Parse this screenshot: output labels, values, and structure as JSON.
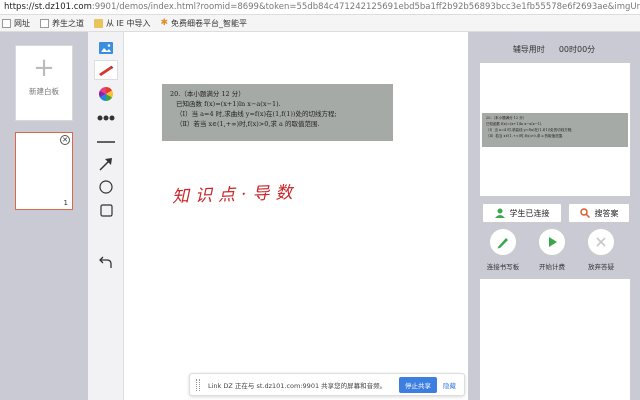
{
  "browser": {
    "url_host": "https://st.dz101.com",
    "url_rest": ":9901/demos/index.html?roomid=8699&token=55db84c471242125691ebd5ba1ff2b92b56893bcc3e1fb55578e6f2693ae&imgUrl=http://uplo..."
  },
  "bookmarks": [
    {
      "label": "网址",
      "icon": "document-icon"
    },
    {
      "label": "养生之道",
      "icon": "document-icon"
    },
    {
      "label": "从 IE 中导入",
      "icon": "folder-icon"
    },
    {
      "label": "免费细卷平台_智能平",
      "icon": "star-icon"
    }
  ],
  "left": {
    "new_board_label": "新建白板",
    "thumb_number": "1"
  },
  "toolbar": {
    "tools": [
      "image-icon",
      "pen-icon",
      "color-wheel-icon",
      "dots-icon",
      "line-icon",
      "arrow-icon",
      "circle-icon",
      "rectangle-icon",
      "undo-icon"
    ]
  },
  "canvas": {
    "problem_lines": [
      "20.（本小题满分 12 分）",
      "已知函数 f(x)=(x+1)ln x−a(x−1).",
      "（Ⅰ）当 a=4 时,求曲线 y=f(x)在(1,f(1))处的切线方程;",
      "（Ⅱ）若当 x∈(1,+∞)时,f(x)>0,求 a 的取值范围."
    ],
    "handwriting": "知识点·导数"
  },
  "share_bar": {
    "message": "Link DZ 正在与 st.dz101.com:9901 共享您的屏幕和音频。",
    "stop_label": "停止共享",
    "hide_label": "隐藏"
  },
  "right": {
    "timer_label": "辅导用时",
    "timer_value": "00时00分",
    "preview_lines": [
      "20.（本小题满分 12 分）",
      "已知函数 f(x)=(x+1)ln x−a(x−1).",
      "（Ⅰ）当 a=4 时,求曲线 y=f(x)在(1,f(1))处的切线方程;",
      "（Ⅱ）若当 x∈(1,+∞)时,f(x)>0,求 a 的取值范围."
    ],
    "student_connected": "学生已连接",
    "search_answer": "搜答案",
    "actions": [
      {
        "label": "连接书写板",
        "color": "#3aa84a"
      },
      {
        "label": "开始计费",
        "color": "#3aa84a"
      },
      {
        "label": "放弃答疑",
        "color": "#c8c8c8"
      }
    ]
  },
  "colors": {
    "accent_blue": "#3c7fe0",
    "green": "#3aa84a",
    "handwriting_red": "#c8262a",
    "thumb_border": "#d86a4a"
  }
}
